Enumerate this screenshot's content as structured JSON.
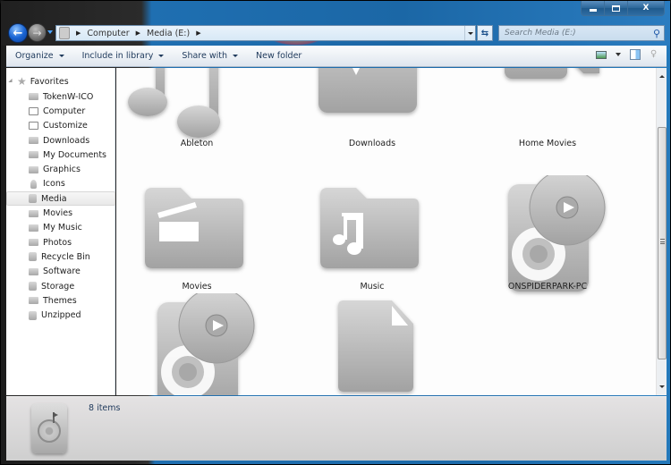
{
  "window": {
    "caption_buttons": [
      "minimize",
      "maximize",
      "close"
    ],
    "close_glyph": "X"
  },
  "navigation": {
    "back_glyph": "←",
    "forward_glyph": "→",
    "breadcrumb": [
      "Computer",
      "Media (E:)"
    ],
    "separator_glyph": "▶",
    "refresh_glyph": "⇆",
    "search_placeholder": "Search Media (E:)",
    "search_value": "",
    "search_glyph": "⚲"
  },
  "toolbar": {
    "organize": "Organize",
    "include_in_library": "Include in library",
    "share_with": "Share with",
    "new_folder": "New folder"
  },
  "sidebar": {
    "favorites_label": "Favorites",
    "star_glyph": "★",
    "items": [
      {
        "label": "TokenW-ICO",
        "icon": "folder-icon"
      },
      {
        "label": "Computer",
        "icon": "computer-icon"
      },
      {
        "label": "Customize",
        "icon": "monitor-icon"
      },
      {
        "label": "Downloads",
        "icon": "folder-icon"
      },
      {
        "label": "My Documents",
        "icon": "folder-icon"
      },
      {
        "label": "Graphics",
        "icon": "folder-icon"
      },
      {
        "label": "Icons",
        "icon": "bulb-icon"
      },
      {
        "label": "Media",
        "icon": "drive-icon",
        "selected": true
      },
      {
        "label": "Movies",
        "icon": "folder-icon"
      },
      {
        "label": "My Music",
        "icon": "folder-icon"
      },
      {
        "label": "Photos",
        "icon": "folder-icon"
      },
      {
        "label": "Recycle Bin",
        "icon": "recycle-bin-icon"
      },
      {
        "label": "Software",
        "icon": "folder-icon"
      },
      {
        "label": "Storage",
        "icon": "drive-icon"
      },
      {
        "label": "Themes",
        "icon": "themes-icon"
      },
      {
        "label": "Unzipped",
        "icon": "zip-icon"
      }
    ]
  },
  "content": {
    "items": [
      {
        "label": "Ableton",
        "icon": "music-notes-icon"
      },
      {
        "label": "Downloads",
        "icon": "downloads-folder-icon"
      },
      {
        "label": "Home Movies",
        "icon": "video-camera-icon"
      },
      {
        "label": "Movies",
        "icon": "movies-folder-icon"
      },
      {
        "label": "Music",
        "icon": "music-folder-icon"
      },
      {
        "label": "ONSPIDERPARK-PC",
        "icon": "media-drive-icon"
      },
      {
        "label": "",
        "icon": "media-drive-icon"
      },
      {
        "label": "",
        "icon": "document-icon"
      }
    ]
  },
  "details": {
    "item_count": "8 items"
  }
}
